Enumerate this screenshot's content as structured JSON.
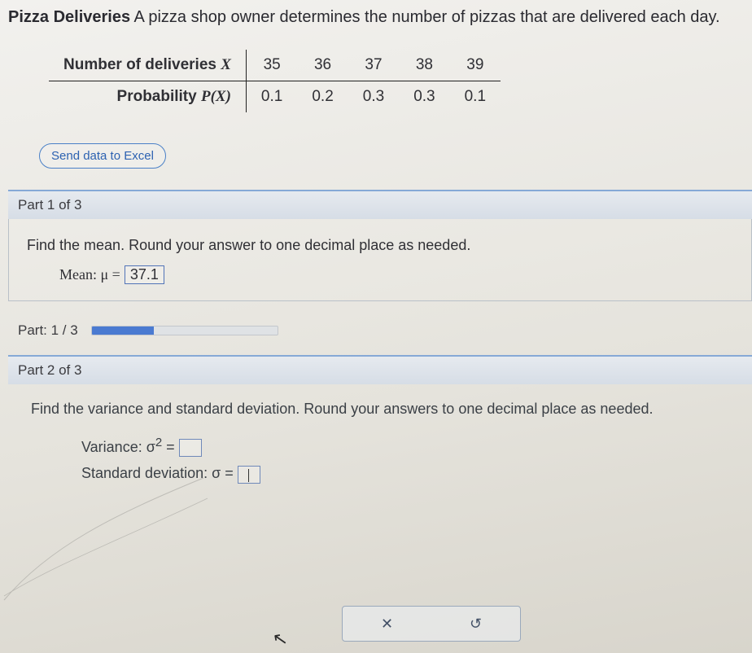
{
  "header": {
    "title_bold": "Pizza Deliveries",
    "title_rest": " A pizza shop owner determines the number of pizzas that are delivered each day."
  },
  "table": {
    "row1_label": "Number of deliveries ",
    "row1_var": "X",
    "row2_label": "Probability ",
    "row2_var": "P(X)",
    "x": [
      "35",
      "36",
      "37",
      "38",
      "39"
    ],
    "p": [
      "0.1",
      "0.2",
      "0.3",
      "0.3",
      "0.1"
    ]
  },
  "excel_button": "Send data to Excel",
  "part1": {
    "header": "Part 1 of 3",
    "prompt": "Find the mean. Round your answer to one decimal place as needed.",
    "mean_label": "Mean: μ =",
    "mean_value": "37.1"
  },
  "progress": {
    "label": "Part: 1 / 3"
  },
  "part2": {
    "header": "Part 2 of 3",
    "prompt": "Find the variance and standard deviation. Round your answers to one decimal place as needed.",
    "variance_label": "Variance: σ",
    "variance_sup": "2",
    "eq": " =",
    "sd_label": "Standard deviation: σ ="
  },
  "actions": {
    "clear": "✕",
    "reset": "↺"
  }
}
